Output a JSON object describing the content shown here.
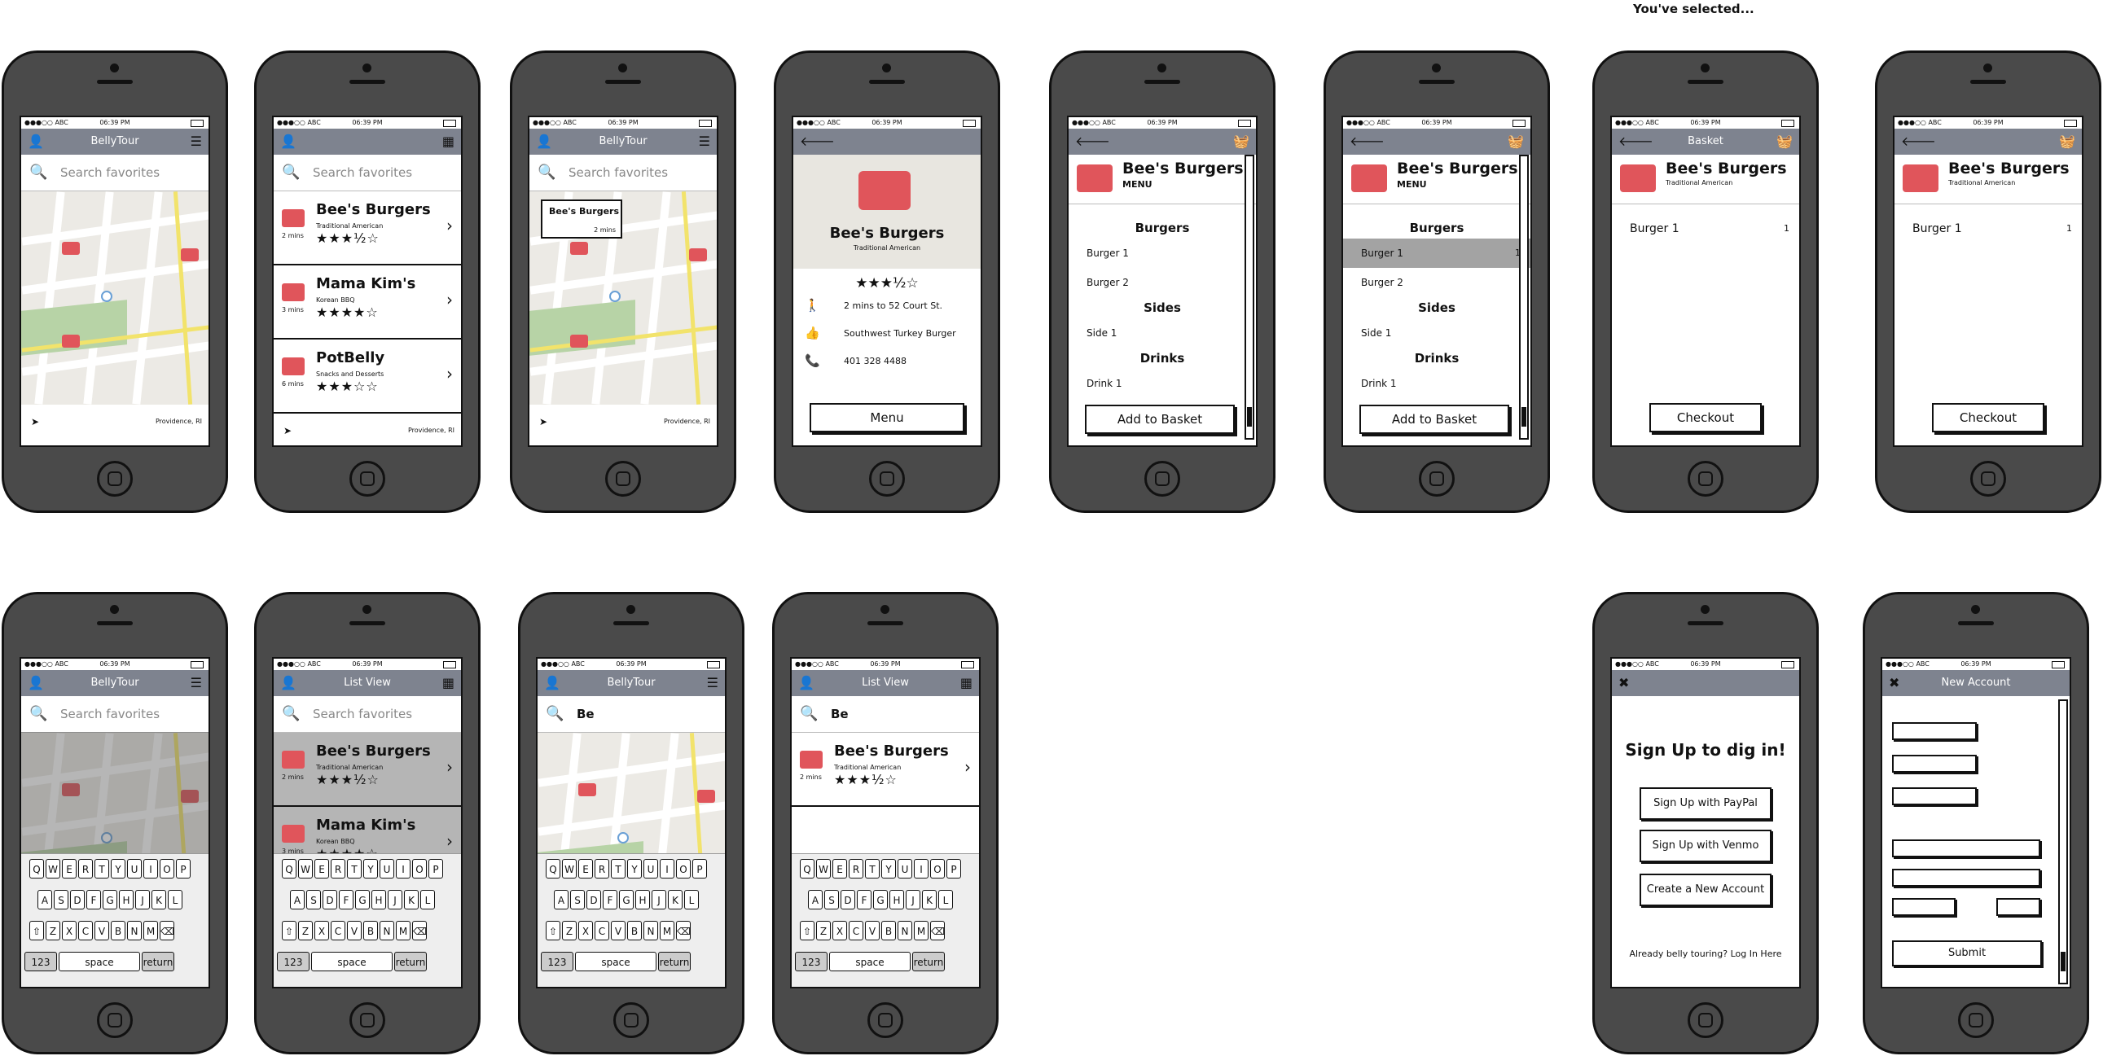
{
  "caption": "You've selected...",
  "status": {
    "carrier": "●●●○○ ABC",
    "time": "06:39 PM"
  },
  "app_title": "BellyTour",
  "list_title": "List View",
  "basket_title": "Basket",
  "new_account_title": "New Account",
  "search": {
    "placeholder": "Search favorites",
    "typed": "Be"
  },
  "location": "Providence, RI",
  "restaurants": [
    {
      "name": "Bee's Burgers",
      "type": "Traditional American",
      "mins": "2 mins",
      "rating": "★★★½☆"
    },
    {
      "name": "Mama Kim's",
      "type": "Korean BBQ",
      "mins": "3 mins",
      "rating": "★★★★☆"
    },
    {
      "name": "PotBelly",
      "type": "Snacks and Desserts",
      "mins": "6 mins",
      "rating": "★★★☆☆"
    }
  ],
  "detail": {
    "rating": "★★★½☆",
    "distance": "2 mins to 52 Court St.",
    "favorite": "Southwest Turkey Burger",
    "phone": "401 328 4488",
    "menu_button": "Menu"
  },
  "menu": {
    "label": "MENU",
    "sections": [
      {
        "title": "Burgers",
        "items": [
          "Burger 1",
          "Burger 2"
        ]
      },
      {
        "title": "Sides",
        "items": [
          "Side 1"
        ]
      },
      {
        "title": "Drinks",
        "items": [
          "Drink 1"
        ]
      }
    ],
    "add_button": "Add to Basket",
    "qty": "1"
  },
  "basket": {
    "item": "Burger 1",
    "qty": "1",
    "checkout": "Checkout"
  },
  "keyboard": {
    "row1": [
      "Q",
      "W",
      "E",
      "R",
      "T",
      "Y",
      "U",
      "I",
      "O",
      "P"
    ],
    "row2": [
      "A",
      "S",
      "D",
      "F",
      "G",
      "H",
      "J",
      "K",
      "L"
    ],
    "row3": [
      "⇧",
      "Z",
      "X",
      "C",
      "V",
      "B",
      "N",
      "M",
      "⌫"
    ],
    "num": "123",
    "space": "space",
    "ret": "return"
  },
  "signup": {
    "title": "Sign Up to dig in!",
    "paypal": "Sign Up with PayPal",
    "venmo": "Sign Up with Venmo",
    "create": "Create a New Account",
    "login": "Already belly touring? Log In Here"
  },
  "submit": "Submit",
  "icons": {
    "user": "👤",
    "list": "☰",
    "map": "▦",
    "search": "🔍",
    "back": "🡐",
    "basket": "🧺",
    "close": "✖",
    "nav": "➤",
    "chev": "›",
    "walk": "🚶",
    "like": "👍",
    "phone": "📞",
    "updown": "⇕"
  },
  "colors": {
    "topbar": "#7e838f",
    "truck": "#e0555b",
    "park": "#b7d3a6",
    "road": "#f2e36b"
  }
}
